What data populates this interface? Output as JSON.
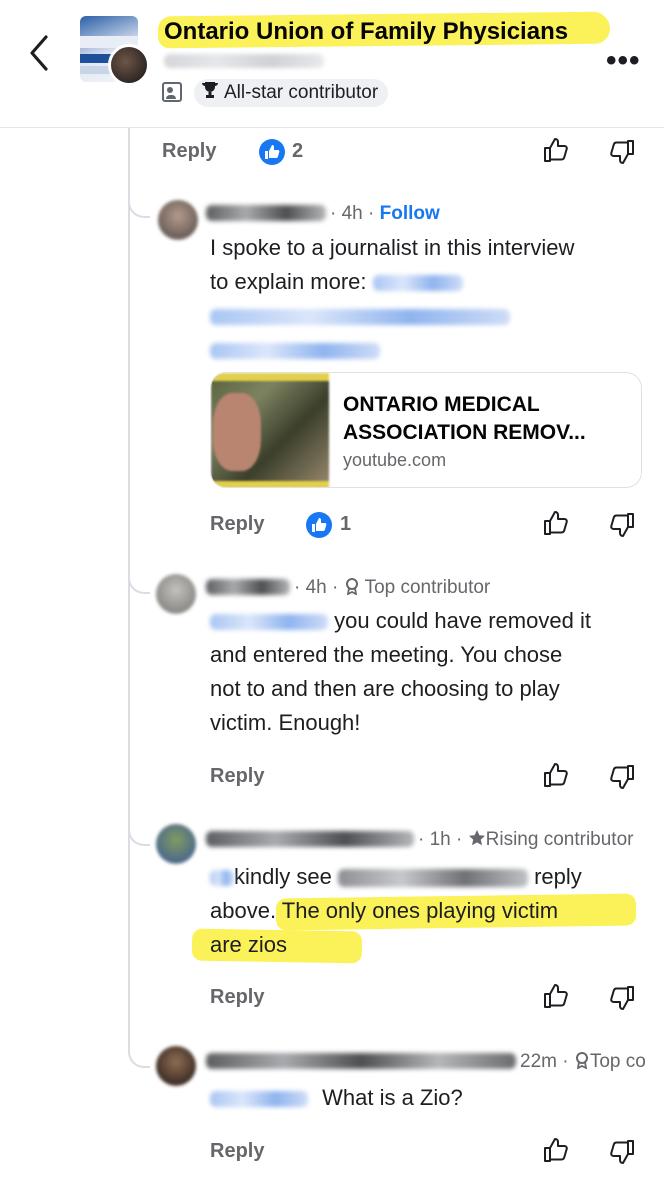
{
  "header": {
    "title": "Ontario Union of Family Physicians",
    "badge": "All-star contributor",
    "more": "•••"
  },
  "top": {
    "reply": "Reply",
    "likes": "2"
  },
  "comments": [
    {
      "meta": "4h",
      "action": "Follow",
      "text_line1": "I spoke to a journalist in this interview",
      "text_line2": "to explain more: ",
      "preview_title_1": "ONTARIO MEDICAL",
      "preview_title_2": "ASSOCIATION REMOV...",
      "preview_domain": "youtube.com",
      "reply": "Reply",
      "likes": "1"
    },
    {
      "meta": "4h",
      "badge": "Top contributor",
      "text_line1": "you could have removed it",
      "text_line2": "and entered the meeting. You chose",
      "text_line3": "not to and then are choosing to play",
      "text_line4": "victim. Enough!",
      "reply": "Reply"
    },
    {
      "meta": "1h",
      "badge": "Rising contributor",
      "text_line1a": "kindly see",
      "text_line1b": "reply",
      "text_line2a": "above",
      "text_line2b": ". The only ones playing victim",
      "text_line3": "are zios",
      "reply": "Reply"
    },
    {
      "meta": "22m",
      "badge": "Top co",
      "text_line1": "What is a Zio?",
      "reply": "Reply"
    }
  ],
  "icons": [
    "back-chevron-icon",
    "members-icon",
    "trophy-icon",
    "like-icon",
    "thumbs-up-icon",
    "thumbs-down-icon",
    "badge-icon",
    "star-icon"
  ],
  "colors": {
    "accent": "#1877f2",
    "highlight": "#fbf25a",
    "muted": "#65676b"
  }
}
